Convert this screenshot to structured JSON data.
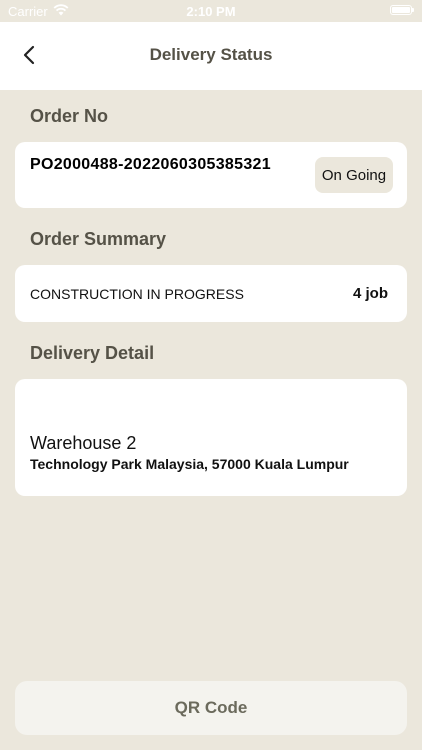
{
  "status_bar": {
    "carrier": "Carrier",
    "time": "2:10 PM"
  },
  "nav": {
    "title": "Delivery Status",
    "back_icon": "chevron-left-icon"
  },
  "order": {
    "section_title": "Order No",
    "number": "PO2000488-2022060305385321",
    "status": "On Going"
  },
  "summary": {
    "section_title": "Order Summary",
    "label": "CONSTRUCTION IN PROGRESS",
    "value": "4 job"
  },
  "delivery": {
    "section_title": "Delivery Detail",
    "warehouse": "Warehouse 2",
    "address": "Technology Park Malaysia, 57000 Kuala Lumpur"
  },
  "actions": {
    "qr_label": "QR Code"
  },
  "colors": {
    "background": "#ebe7dc",
    "card": "#ffffff",
    "title_text": "#555247",
    "button_text": "#6b6a5c"
  }
}
